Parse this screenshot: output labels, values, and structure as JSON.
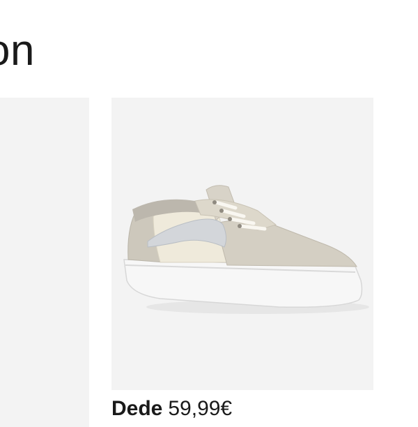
{
  "heading": {
    "text": "on"
  },
  "product": {
    "image_alt": "sneaker",
    "price_prefix": "Dede",
    "price_value": "59,99€"
  }
}
